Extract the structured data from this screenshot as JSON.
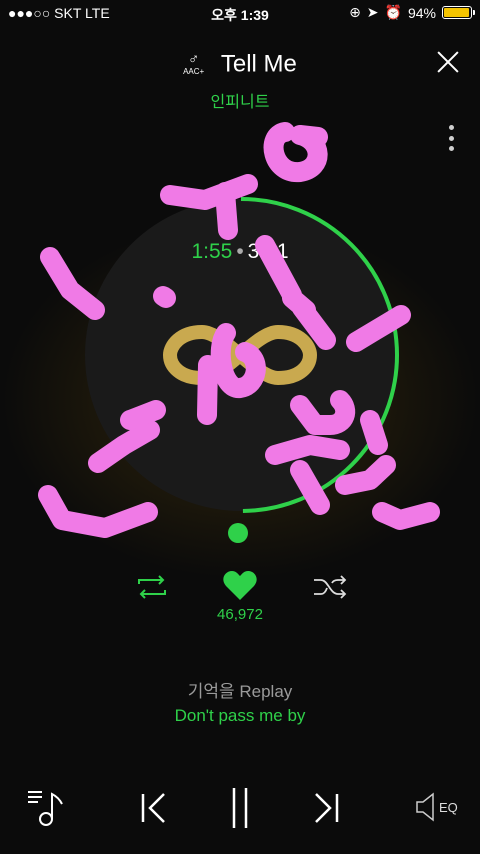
{
  "status_bar": {
    "carrier": "●●●○○ SKT   LTE",
    "time": "오후 1:39",
    "battery_pct": "94%",
    "battery_level": 0.94
  },
  "header": {
    "badge": "AAC+",
    "badge_glyph": "♂",
    "title": "Tell Me",
    "artist": "인피니트"
  },
  "player": {
    "elapsed": "1:55",
    "separator": "•",
    "duration": "3:51",
    "progress": 0.4978,
    "likes": "46,972",
    "accent": "#2fd14a"
  },
  "lyrics": {
    "previous": "기억을 Replay",
    "current": "Don't pass me by"
  },
  "bottom_bar": {
    "eq_label": "EQ"
  },
  "icons": [
    "signal-icon",
    "battery-icon",
    "alarm-icon",
    "location-icon",
    "lock-rotation-icon",
    "close-icon",
    "more-vertical-icon",
    "repeat-icon",
    "heart-icon",
    "shuffle-icon",
    "playlist-icon",
    "previous-icon",
    "pause-icon",
    "next-icon",
    "equalizer-icon"
  ]
}
